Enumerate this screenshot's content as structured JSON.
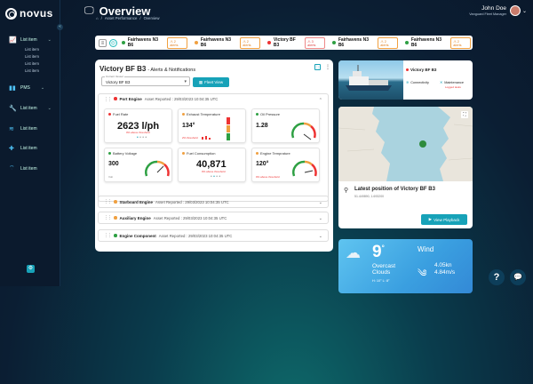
{
  "brand": {
    "name": "novus"
  },
  "sidebar": {
    "items": [
      {
        "label": "List item",
        "icon": "chart-line-icon",
        "sub": [
          "List item",
          "List item",
          "List item",
          "List item"
        ]
      },
      {
        "label": "PMS",
        "icon": "chart-bar-icon",
        "sub": []
      },
      {
        "label": "List item",
        "icon": "wrench-icon",
        "sub": []
      },
      {
        "label": "List item",
        "icon": "signal-icon",
        "sub": []
      },
      {
        "label": "List item",
        "icon": "plus-cross-icon",
        "sub": []
      },
      {
        "label": "List item",
        "icon": "wifi-icon",
        "sub": []
      }
    ]
  },
  "header": {
    "title": "Overview",
    "breadcrumb": [
      "Asset Performance",
      "Overview"
    ]
  },
  "user": {
    "name": "John Doe",
    "role": "Vanguard Fleet Manager"
  },
  "fleet_bar": {
    "vessels": [
      {
        "name": "Fairhavens N3 B6",
        "alerts": "2 alerts",
        "dot": "#2ea043",
        "alert_color": "orange"
      },
      {
        "name": "Fairhavens N3 B6",
        "alerts": "2 alerts",
        "dot": "#f0a040",
        "alert_color": "orange"
      },
      {
        "name": "Victory BF B3",
        "alerts": "3 alerts",
        "dot": "#e33",
        "alert_color": "red"
      },
      {
        "name": "Fairhavens N3 B6",
        "alerts": "2 alerts",
        "dot": "#2ea043",
        "alert_color": "orange"
      },
      {
        "name": "Fairhavens N3 B6",
        "alerts": "2 alerts",
        "dot": "#2ea043",
        "alert_color": "orange"
      }
    ]
  },
  "main": {
    "title": "Victory BF B3",
    "subtitle": "- Alerts & Notifications",
    "select_label": "Current Vessel",
    "select_value": "Victory BF B3",
    "fleet_button": "Fleet View",
    "sections": [
      {
        "name": "Port Engine",
        "reported": "Asset Reported : 29/03/2023 10:04:35 UTC",
        "dot": "#e33"
      },
      {
        "name": "Starboard Engine",
        "reported": "Asset Reported : 29/03/2023 10:04:35 UTC",
        "dot": "#f0a040"
      },
      {
        "name": "Auxiliary Engine",
        "reported": "Asset Reported : 29/03/2023 10:04:35 UTC",
        "dot": "#f0a040"
      },
      {
        "name": "Engine Component",
        "reported": "Asset Reported : 29/03/2023 10:04:35 UTC",
        "dot": "#2ea043"
      }
    ],
    "gauges": [
      {
        "label": "Fuel Rate",
        "value": "2623 l/ph",
        "note": "0% above threshold",
        "dot": "#e33"
      },
      {
        "label": "Exhaust Temperature",
        "value": "134°",
        "note": "2% threshold",
        "dot": "#f0a040"
      },
      {
        "label": "Oil Pressure",
        "value": "1.28",
        "note": "",
        "dot": "#2ea043"
      },
      {
        "label": "Battery Voltage",
        "value": "300",
        "note": "Volt",
        "dot": "#2ea043"
      },
      {
        "label": "Fuel Consumption",
        "value": "40,871",
        "note": "0% above threshold",
        "dot": "#f0a040"
      },
      {
        "label": "Engine Temprature",
        "value": "120°",
        "note": "0% above threshold",
        "dot": "#f0a040"
      }
    ]
  },
  "ship": {
    "name": "Victory BF B3",
    "connectivity": "Connectivity",
    "maintenance": "Maintenance",
    "maintenance_note": "Logged tasks"
  },
  "map": {
    "title": "Latest position of Victory BF B3",
    "sub": "51.449890, 1.693200",
    "button": "View Playback"
  },
  "weather": {
    "temp": "9",
    "unit": "°",
    "desc1": "Overcast",
    "desc2": "Clouds",
    "hilo": "H: 10° L: 8°",
    "wind_title": "Wind",
    "wind_speed": "4.05kn",
    "wind_ms": "4.84m/s"
  },
  "colors": {
    "accent": "#17a2b8",
    "red": "#e33",
    "orange": "#f0a040",
    "green": "#2ea043"
  }
}
